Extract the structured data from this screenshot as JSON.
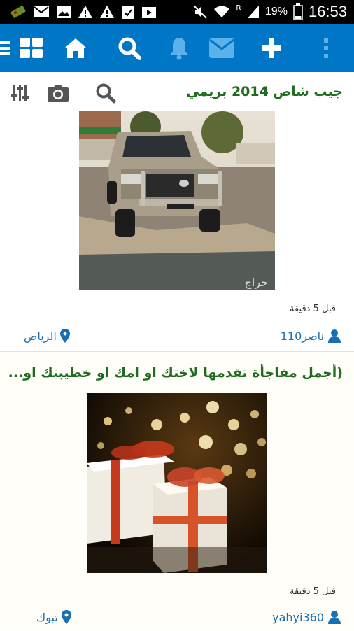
{
  "status_bar": {
    "battery_percent": "19%",
    "time": "16:53",
    "signal_indicator": "R"
  },
  "nav": {
    "icons": [
      "menu-icon",
      "grid-icon",
      "home-icon",
      "search-icon",
      "bell-icon",
      "mail-icon",
      "plus-icon",
      "more-vertical-icon"
    ]
  },
  "toolbar": {
    "icons": [
      "filter-sliders-icon",
      "camera-icon",
      "search-icon"
    ]
  },
  "posts": [
    {
      "title": "جيب شاص 2014 بريمي",
      "time": "قبل 5 دقيقة",
      "user": "ناصر110",
      "city": "الرياض",
      "image_watermark": "حراج"
    },
    {
      "title": "(أجمل مفاجأة تقدمها لاختك او امك او خطيبتك او...",
      "time": "قبل 5 دقيقة",
      "user": "yahyi360",
      "city": "تبوك"
    }
  ],
  "colors": {
    "nav_bg": "#0076c6",
    "title_green": "#1f6c1f",
    "link_blue": "#1a6fb2"
  }
}
